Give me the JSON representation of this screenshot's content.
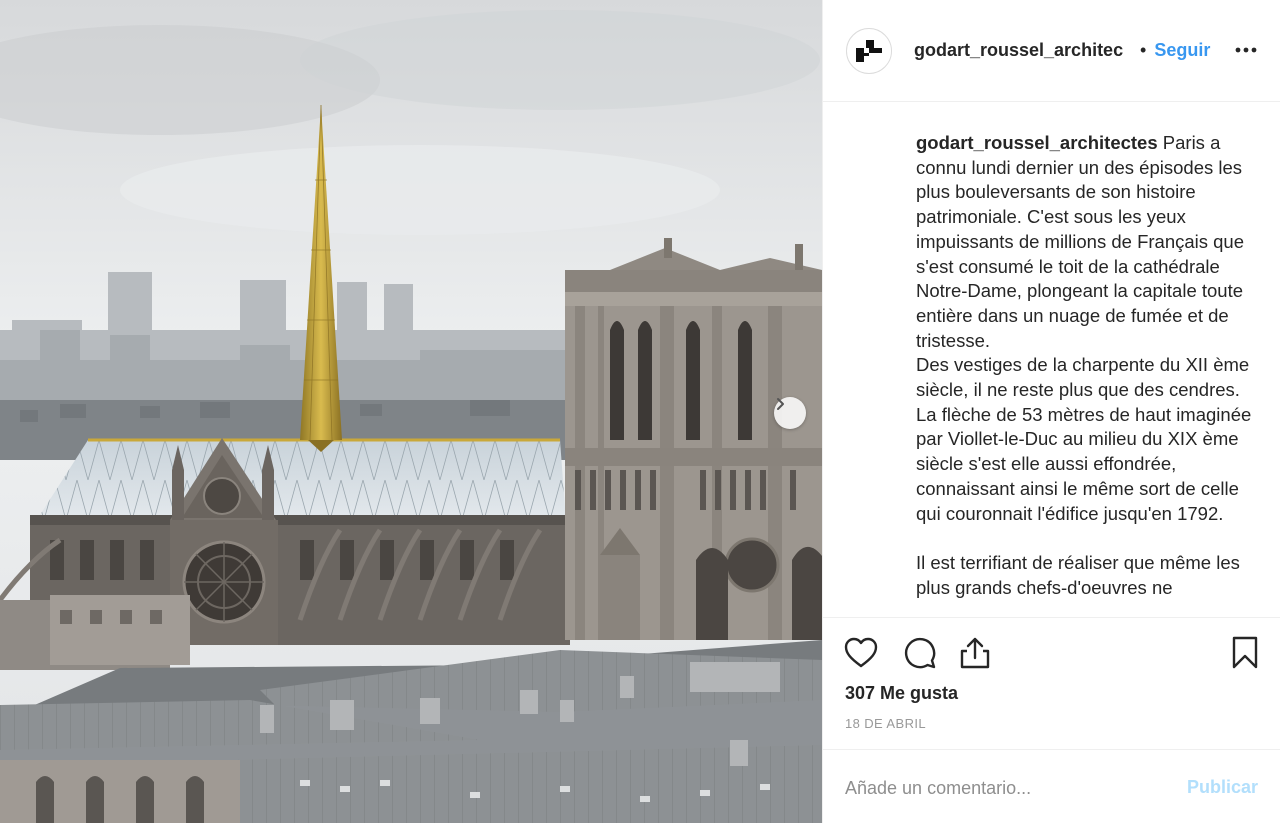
{
  "post": {
    "image": {
      "alt_icon": "cathedral-photo"
    },
    "header": {
      "username": "godart_roussel_architec",
      "separator": "•",
      "follow_label": "Seguir",
      "more_icon": "ellipsis-icon"
    },
    "caption": {
      "username": "godart_roussel_architectes",
      "para1": "Paris a connu lundi dernier un des épisodes les plus bouleversants de son histoire patrimoniale. C'est sous les yeux impuissants de millions de Français que s'est consumé le toit de la cathédrale Notre-Dame, plongeant la capitale toute entière dans un nuage de fumée et de tristesse.",
      "para2": "Des vestiges de la charpente du XII ème siècle, il ne reste plus que des cendres. La flèche de 53 mètres de haut imaginée par Viollet-le-Duc au milieu du XIX ème siècle s'est elle aussi effondrée, connaissant ainsi le même sort de celle qui couronnait l'édifice jusqu'en 1792.",
      "para3": "Il est terrifiant de réaliser que même les plus grands chefs-d'oeuvres ne"
    },
    "actions": {
      "likes": "307 Me gusta",
      "date": "18 DE ABRIL"
    },
    "comment": {
      "placeholder": "Añade un comentario...",
      "publish_label": "Publicar"
    },
    "colors": {
      "link_blue": "#3897f0",
      "publish_disabled": "#b2dffc",
      "border": "#efefef",
      "spire_gold": "#c9a83a"
    }
  }
}
